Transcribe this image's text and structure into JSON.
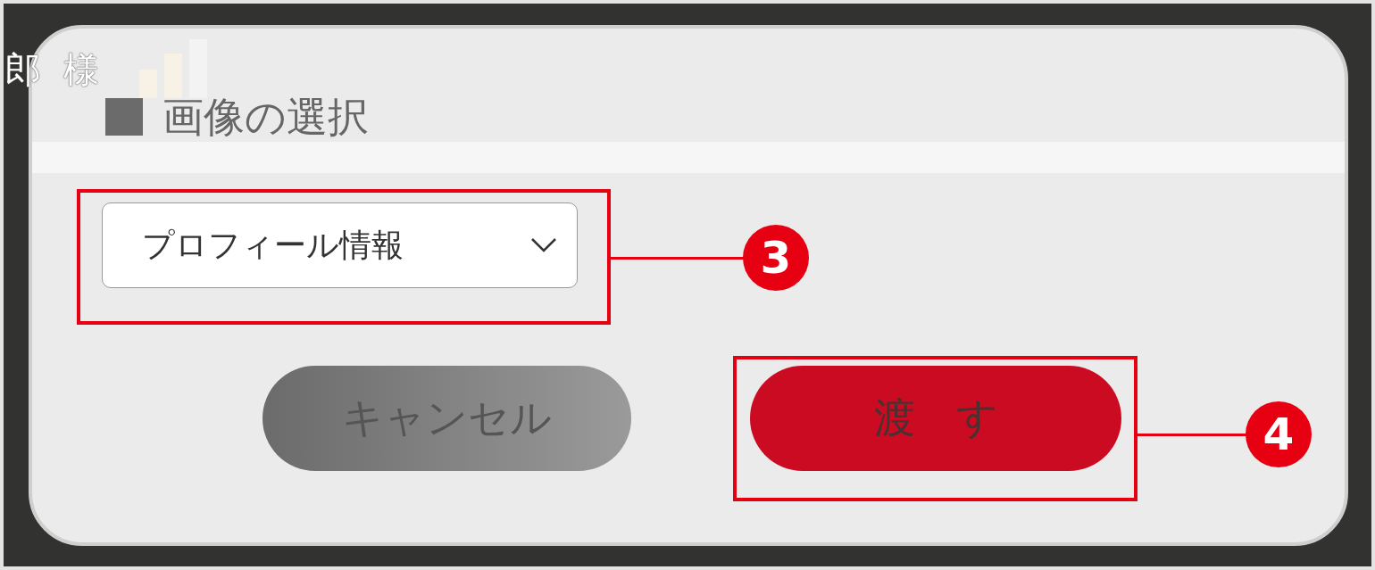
{
  "background": {
    "user_name": "郎 様"
  },
  "dialog": {
    "title": "画像の選択",
    "dropdown": {
      "value": "プロフィール情報"
    },
    "buttons": [
      {
        "label": "キャンセル",
        "kind": "secondary"
      },
      {
        "label": "渡　す",
        "kind": "primary"
      }
    ]
  },
  "annotations": [
    {
      "number": "3"
    },
    {
      "number": "4"
    }
  ]
}
